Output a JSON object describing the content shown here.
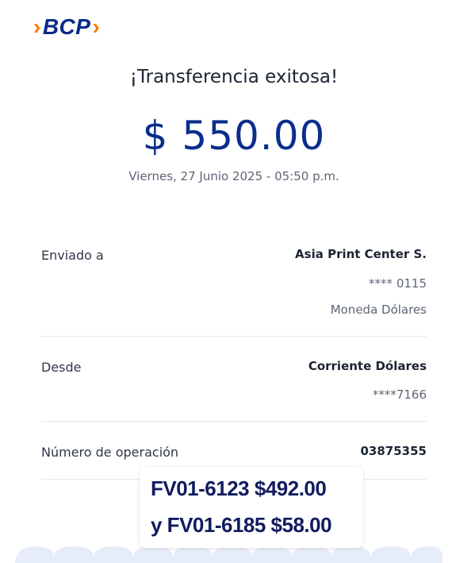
{
  "brand": {
    "logo_text": "BCP",
    "color_primary": "#0a2a8a",
    "color_accent": "#ff7a00"
  },
  "header": {
    "title": "¡Transferencia exitosa!",
    "amount": "$ 550.00",
    "datetime": "Viernes, 27 Junio 2025 - 05:50 p.m."
  },
  "details": {
    "sent_to": {
      "label": "Enviado a",
      "name": "Asia Print Center S.",
      "account": "**** 0115",
      "currency": "Moneda Dólares"
    },
    "from": {
      "label": "Desde",
      "account_type": "Corriente Dólares",
      "account": "****7166"
    },
    "operation": {
      "label": "Número de operación",
      "number": "03875355"
    }
  },
  "overlay_note": {
    "line1": "FV01-6123  $492.00",
    "line2": "y FV01-6185 $58.00"
  }
}
